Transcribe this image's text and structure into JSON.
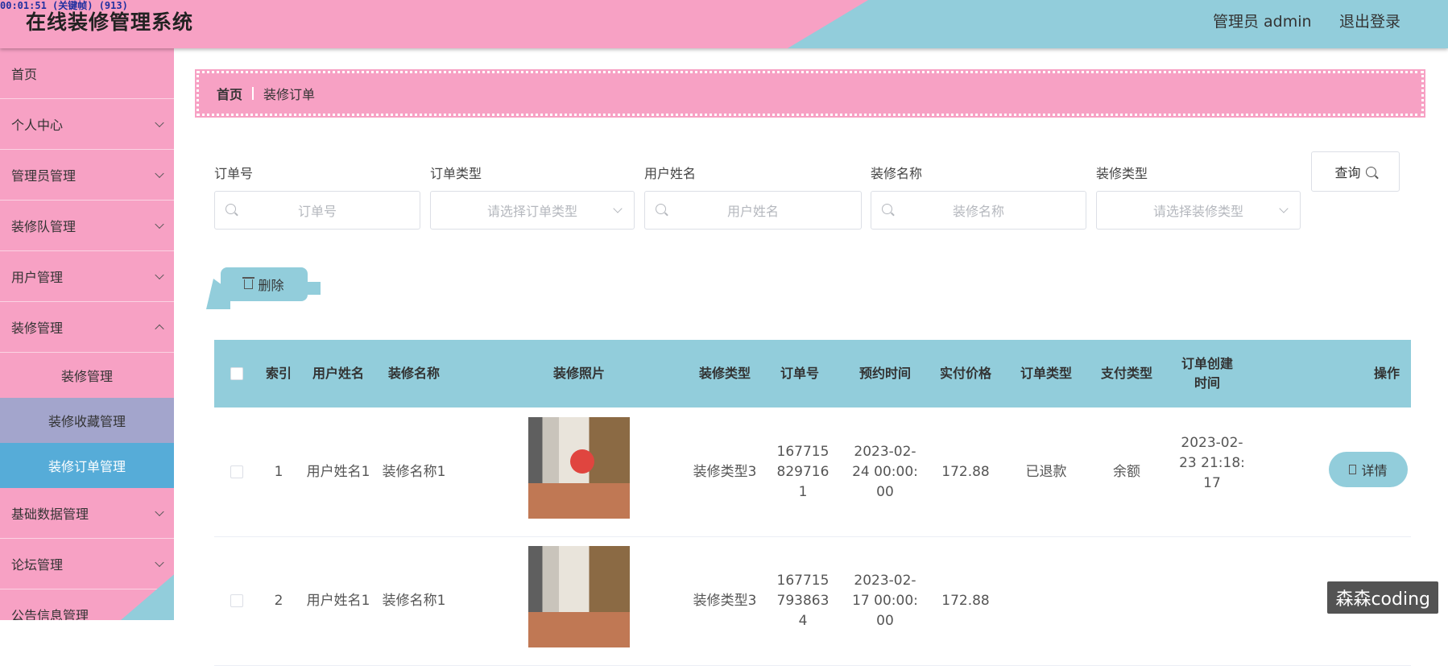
{
  "timestamp": "00:01:51 (关键帧) (913)",
  "app_title": "在线装修管理系统",
  "header": {
    "admin_label": "管理员 admin",
    "logout": "退出登录"
  },
  "sidebar": {
    "items": [
      {
        "label": "首页",
        "expandable": false
      },
      {
        "label": "个人中心",
        "expandable": true
      },
      {
        "label": "管理员管理",
        "expandable": true
      },
      {
        "label": "装修队管理",
        "expandable": true
      },
      {
        "label": "用户管理",
        "expandable": true
      },
      {
        "label": "装修管理",
        "expandable": true
      }
    ],
    "sub_items": [
      "装修管理",
      "装修收藏管理",
      "装修订单管理"
    ],
    "items_after": [
      {
        "label": "基础数据管理"
      },
      {
        "label": "论坛管理"
      },
      {
        "label": "公告信息管理"
      }
    ]
  },
  "breadcrumb": {
    "home": "首页",
    "current": "装修订单"
  },
  "filters": {
    "order_no": {
      "label": "订单号",
      "placeholder": "订单号"
    },
    "order_type": {
      "label": "订单类型",
      "placeholder": "请选择订单类型"
    },
    "user_name": {
      "label": "用户姓名",
      "placeholder": "用户姓名"
    },
    "reno_name": {
      "label": "装修名称",
      "placeholder": "装修名称"
    },
    "reno_type": {
      "label": "装修类型",
      "placeholder": "请选择装修类型"
    },
    "query_label": "查询"
  },
  "actions": {
    "delete_label": "删除"
  },
  "table": {
    "headers": [
      "索引",
      "用户姓名",
      "装修名称",
      "装修照片",
      "装修类型",
      "订单号",
      "预约时间",
      "实付价格",
      "订单类型",
      "支付类型",
      "订单创建时间",
      "操作"
    ],
    "rows": [
      {
        "index": "1",
        "user_name": "用户姓名1",
        "reno_name": "装修名称1",
        "reno_type": "装修类型3",
        "order_no": "1677158297161",
        "appointment": "2023-02-24 00:00:00",
        "price": "172.88",
        "order_type": "已退款",
        "pay_type": "余额",
        "created": "2023-02-23 21:18:17",
        "detail_label": "详情"
      },
      {
        "index": "2",
        "user_name": "用户姓名1",
        "reno_name": "装修名称1",
        "reno_type": "装修类型3",
        "order_no": "1677157938634",
        "appointment": "2023-02-17 00:00:00",
        "price": "172.88"
      }
    ]
  },
  "watermark": "森森coding"
}
